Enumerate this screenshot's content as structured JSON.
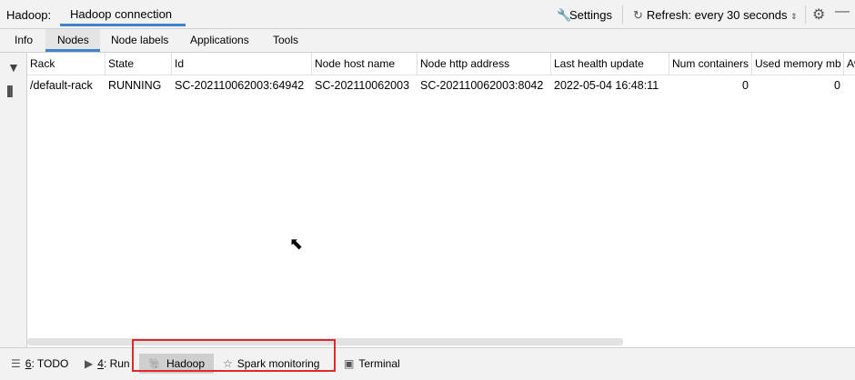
{
  "header": {
    "prefix": "Hadoop:",
    "connection_tab": "Hadoop connection",
    "settings_label": "Settings",
    "refresh_label": "Refresh: every 30 seconds"
  },
  "subtabs": [
    "Info",
    "Nodes",
    "Node labels",
    "Applications",
    "Tools"
  ],
  "table": {
    "columns": [
      "Rack",
      "State",
      "Id",
      "Node host name",
      "Node http address",
      "Last health update",
      "Num containers",
      "Used memory mb",
      "Av"
    ],
    "rows": [
      [
        "/default-rack",
        "RUNNING",
        "SC-202110062003:64942",
        "SC-202110062003",
        "SC-202110062003:8042",
        "2022-05-04 16:48:11",
        "0",
        "0",
        ""
      ]
    ]
  },
  "bottom": {
    "todo_num": "6",
    "todo_label": ": TODO",
    "run_num": "4",
    "run_label": ": Run",
    "hadoop_label": "Hadoop",
    "spark_label": "Spark monitoring",
    "terminal_label": "Terminal"
  },
  "colors": {
    "accent": "#4083c9",
    "highlight": "#e0282a"
  }
}
